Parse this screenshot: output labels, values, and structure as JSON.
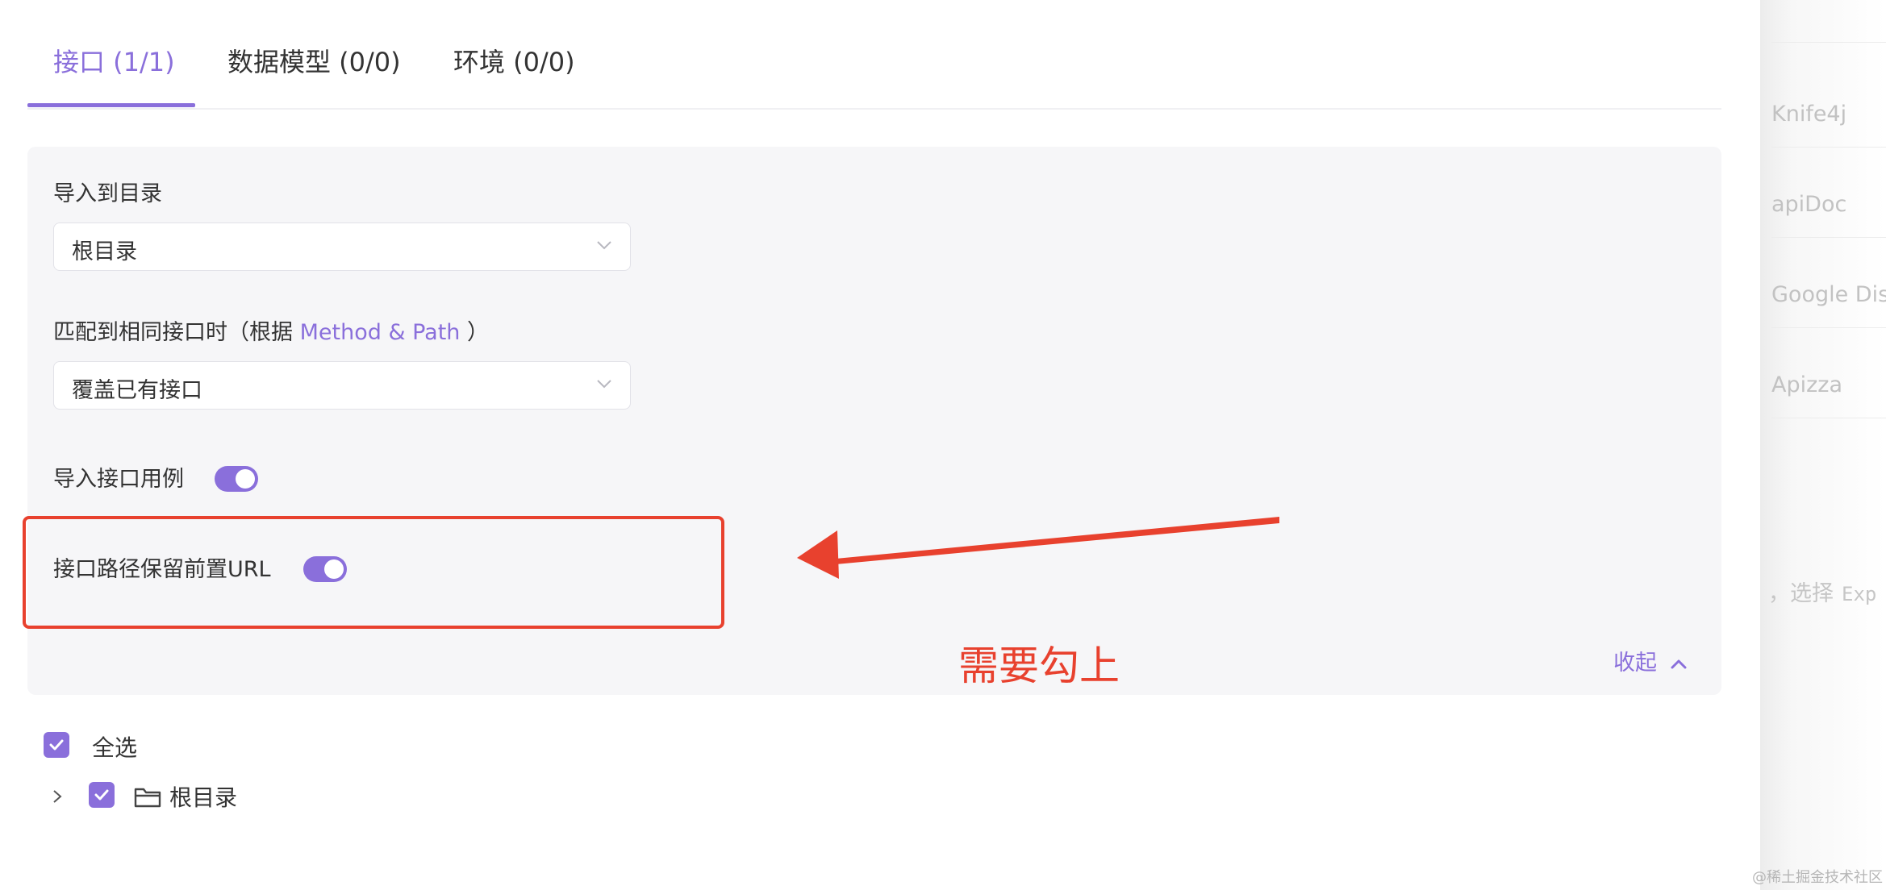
{
  "tabs": [
    {
      "label": "接口 (1/1)",
      "active": true
    },
    {
      "label": "数据模型 (0/0)",
      "active": false
    },
    {
      "label": "环境 (0/0)",
      "active": false
    }
  ],
  "settings": {
    "import_dir_label": "导入到目录",
    "import_dir_value": "根目录",
    "match_label_prefix": "匹配到相同接口时（根据 ",
    "match_label_accent": "Method & Path",
    "match_label_suffix": " ）",
    "match_value": "覆盖已有接口",
    "import_cases_label": "导入接口用例",
    "import_cases_enabled": true,
    "keep_prefix_label": "接口路径保留前置URL",
    "keep_prefix_enabled": true,
    "collapse_label": "收起"
  },
  "annotation": {
    "text": "需要勾上",
    "color": "#e8412e"
  },
  "tree": {
    "select_all_label": "全选",
    "select_all_checked": true,
    "root_label": "根目录",
    "root_checked": true
  },
  "right_panel": {
    "items": [
      "Knife4j",
      "apiDoc",
      "Google Disc",
      "Apizza"
    ],
    "hint_text": "，选择",
    "hint_code": "Exp"
  },
  "watermark": "@稀土掘金技术社区",
  "colors": {
    "accent": "#8a6fdb",
    "annotation_red": "#e8412e",
    "panel_bg": "#f6f6f8"
  },
  "icons": {
    "dropdown": "chevron-down-icon",
    "collapse": "chevron-up-icon",
    "check": "check-icon",
    "expand": "chevron-right-icon",
    "folder": "folder-icon"
  }
}
